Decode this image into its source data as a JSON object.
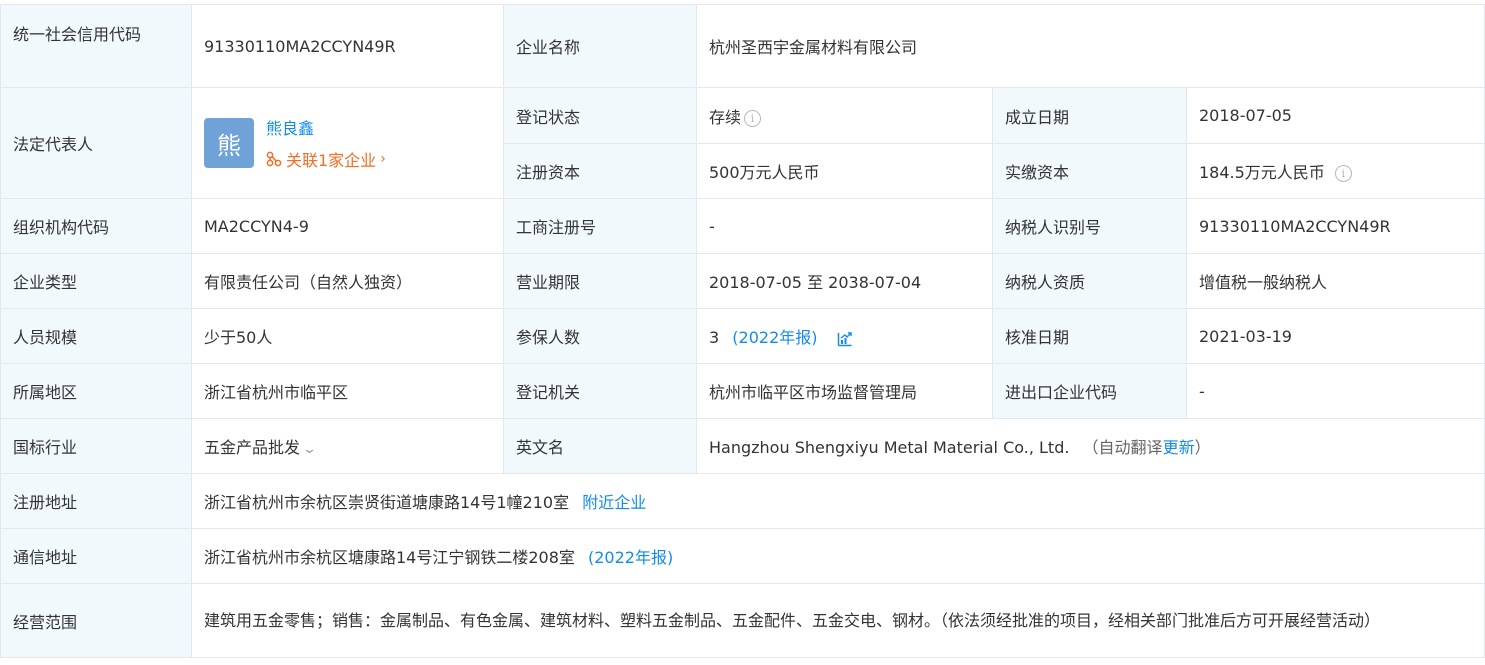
{
  "labels": {
    "credit_code": "统一社会信用代码",
    "company_name": "企业名称",
    "legal_rep": "法定代表人",
    "reg_status": "登记状态",
    "found_date": "成立日期",
    "reg_capital": "注册资本",
    "paid_capital": "实缴资本",
    "org_code": "组织机构代码",
    "biz_reg_no": "工商注册号",
    "taxpayer_id": "纳税人识别号",
    "company_type": "企业类型",
    "biz_term": "营业期限",
    "taxpayer_qual": "纳税人资质",
    "staff_size": "人员规模",
    "insured": "参保人数",
    "approval_date": "核准日期",
    "region": "所属地区",
    "reg_authority": "登记机关",
    "ie_code": "进出口企业代码",
    "industry": "国标行业",
    "english_name": "英文名",
    "reg_address": "注册地址",
    "mail_address": "通信地址",
    "biz_scope": "经营范围"
  },
  "values": {
    "credit_code": "91330110MA2CCYN49R",
    "company_name": "杭州圣西宇金属材料有限公司",
    "rep_avatar": "熊",
    "rep_name": "熊良鑫",
    "rep_assoc": "关联1家企业",
    "reg_status": "存续",
    "found_date": "2018-07-05",
    "reg_capital": "500万元人民币",
    "paid_capital": "184.5万元人民币",
    "org_code": "MA2CCYN4-9",
    "biz_reg_no": "-",
    "taxpayer_id": "91330110MA2CCYN49R",
    "company_type": "有限责任公司（自然人独资）",
    "biz_term": "2018-07-05 至 2038-07-04",
    "taxpayer_qual": "增值税一般纳税人",
    "staff_size": "少于50人",
    "insured_count": "3",
    "insured_year": "(2022年报)",
    "approval_date": "2021-03-19",
    "region": "浙江省杭州市临平区",
    "reg_authority": "杭州市临平区市场监督管理局",
    "ie_code": "-",
    "industry": "五金产品批发",
    "english_name": "Hangzhou Shengxiyu Metal Material Co., Ltd.",
    "translate_open": "（自动翻译",
    "translate_update": "更新",
    "translate_close": "）",
    "reg_address": "浙江省杭州市余杭区崇贤街道塘康路14号1幢210室",
    "nearby": "附近企业",
    "mail_address": "浙江省杭州市余杭区塘康路14号江宁钢铁二楼208室",
    "mail_year": "(2022年报)",
    "biz_scope": "建筑用五金零售；销售：金属制品、有色金属、建筑材料、塑料五金制品、五金配件、五金交电、钢材。（依法须经批准的项目，经相关部门批准后方可开展经营活动）"
  },
  "icons": {
    "info": "info-circle-icon",
    "assoc": "network-icon",
    "chart": "trend-chart-icon",
    "chevron": "chevron-right-icon",
    "dropdown": "chevron-down-icon"
  },
  "colors": {
    "label_bg": "#f2f9fc",
    "border": "#e4e8ee",
    "link": "#128bed",
    "accent_orange": "#f46e23",
    "avatar_bg": "#6fa3d8"
  }
}
